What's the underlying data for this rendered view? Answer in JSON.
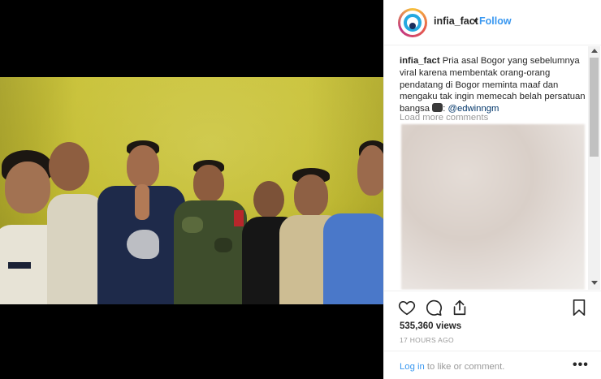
{
  "post": {
    "username": "infia_fact",
    "separator": "•",
    "follow_label": "Follow"
  },
  "caption": {
    "user": "infia_fact",
    "text": "Pria asal Bogor yang sebelumnya viral karena membentak orang-orang pendatang di Bogor meminta maaf dan mengaku tak ingin memecah belah persatuan bangsa",
    "after_emoji": ":",
    "mention": "@edwinngm"
  },
  "comments": {
    "load_more": "Load more comments"
  },
  "stats": {
    "views": "535,360 views",
    "time_ago": "17 HOURS AGO"
  },
  "footer": {
    "login_link": "Log in",
    "login_rest": "to like or comment.",
    "more": "•••"
  },
  "icons": [
    "heart-icon",
    "comment-icon",
    "share-icon",
    "bookmark-icon",
    "more-options-icon"
  ],
  "colors": {
    "accent": "#3897f0",
    "mention": "#003569",
    "muted": "#999999",
    "wall": "#c2bb2f"
  }
}
